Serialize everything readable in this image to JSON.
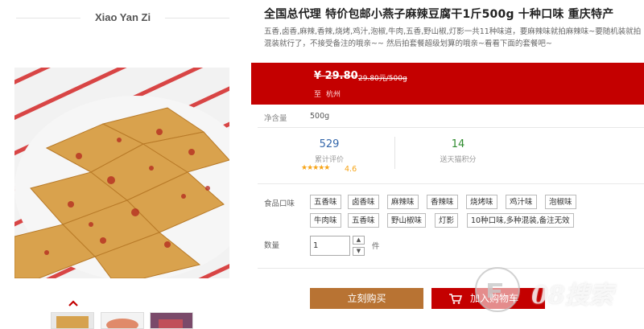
{
  "shop": {
    "name": "Xiao Yan Zi"
  },
  "product": {
    "title": "全国总代理 特价包邮小燕子麻辣豆腐干1斤500g 十种口味 重庆特产",
    "subtitle": "五香,卤香,麻辣,香辣,烧烤,鸡汁,泡椒,牛肉,五香,野山椒,灯影一共11种味道，要麻辣味就拍麻辣味~要随机装就拍混装就行了，不接受备注的哦亲~~ 然后拍套餐超级划算的哦亲~看看下面的套餐吧~"
  },
  "price": {
    "old": "¥ 29.80",
    "unit": "29.80元/500g",
    "ship_label": "至",
    "ship_city": "杭州"
  },
  "spec": {
    "label": "净含量",
    "value": "500g"
  },
  "stats": {
    "reviews_count": "529",
    "reviews_label": "累计评价",
    "rating_stars": "★★★★★",
    "rating": "4.6",
    "points": "14",
    "points_label": "送天猫积分"
  },
  "options": {
    "label": "食品口味",
    "row1": [
      "五香味",
      "卤香味",
      "麻辣味",
      "香辣味",
      "烧烤味",
      "鸡汁味",
      "泡椒味"
    ],
    "row2": [
      "牛肉味",
      "五香味",
      "野山椒味",
      "灯影",
      "10种口味,多种混装,备注无效"
    ]
  },
  "quantity": {
    "label": "数量",
    "value": "1",
    "unit": "件",
    "up": "▲",
    "down": "▼"
  },
  "buttons": {
    "buy": "立刻购买",
    "cart": "加入购物车"
  },
  "watermark": {
    "text": "08搜索"
  },
  "colors": {
    "price_bar": "#c40000",
    "buy_button": "#b87333",
    "cart_button": "#c40000",
    "points": "#2e8b2e",
    "reviews": "#3366aa"
  },
  "icons": [
    "chevron-up-icon",
    "cart-icon"
  ]
}
